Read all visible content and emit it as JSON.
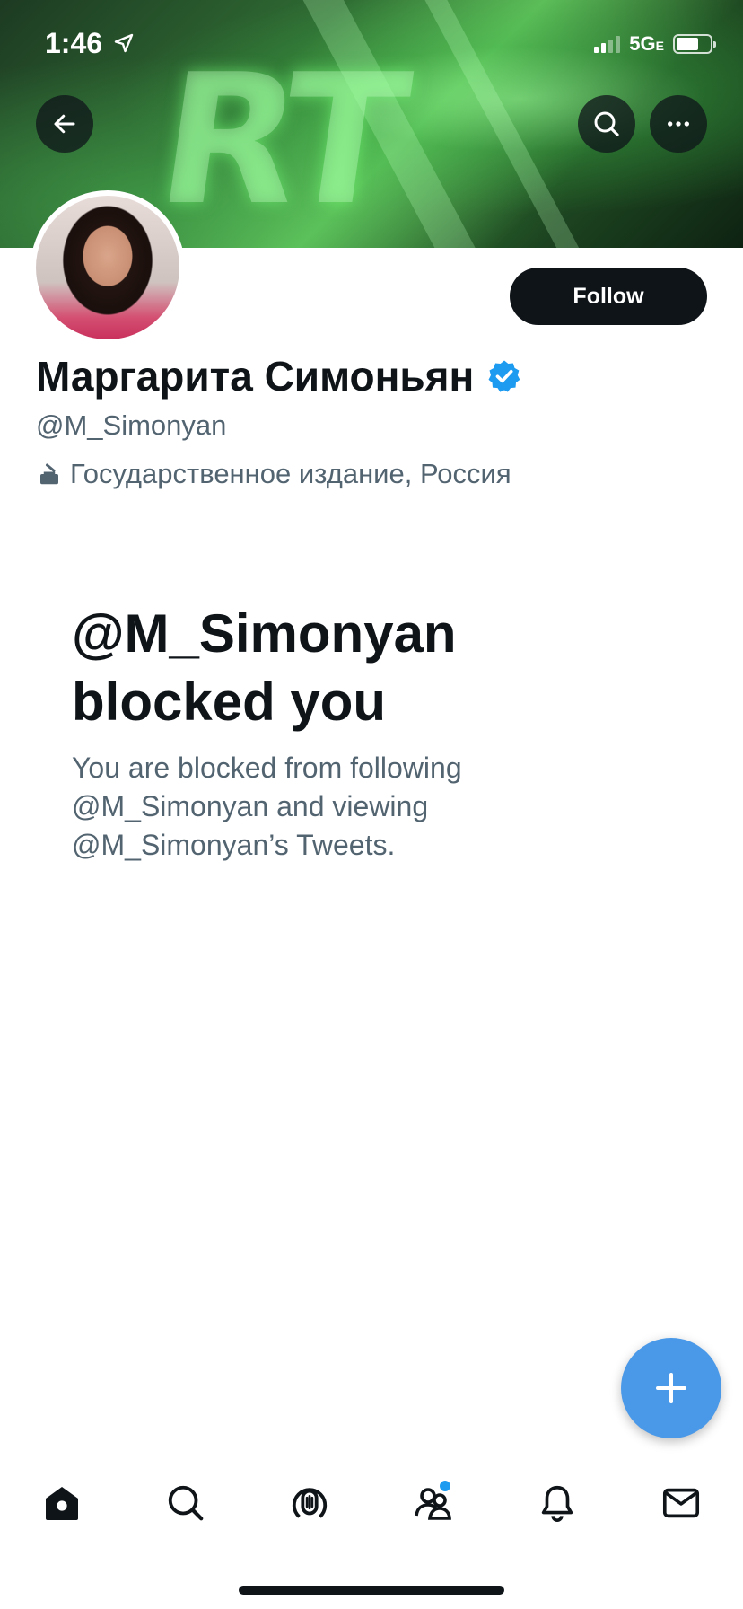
{
  "status_bar": {
    "time": "1:46",
    "network": "5G",
    "network_suffix": "E"
  },
  "header": {
    "banner_text": "RT"
  },
  "profile": {
    "follow_label": "Follow",
    "display_name": "Маргарита Симоньян",
    "handle": "@M_Simonyan",
    "label_text": "Государственное издание, Россия",
    "verified": true
  },
  "blocked": {
    "title_line1": "@M_Simonyan",
    "title_line2": "blocked you",
    "body_line1": "You are blocked from following",
    "body_line2": "@M_Simonyan and viewing",
    "body_line3": "@M_Simonyan’s Tweets."
  },
  "fab": {
    "icon": "plus-icon"
  },
  "bottom_nav": {
    "items": [
      "home-icon",
      "search-icon",
      "spaces-icon",
      "communities-icon",
      "notifications-icon",
      "messages-icon"
    ]
  },
  "colors": {
    "accent": "#1d9bf0",
    "fab": "#4a99e9",
    "text_primary": "#0f1419",
    "text_secondary": "#536471"
  }
}
